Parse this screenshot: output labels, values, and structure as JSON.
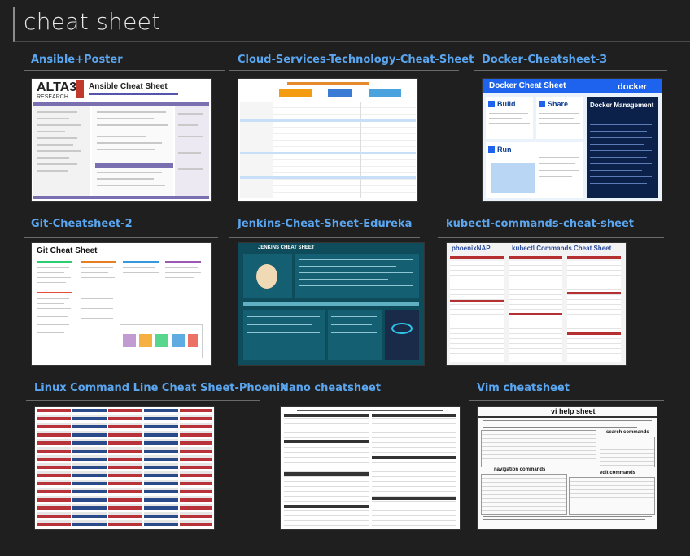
{
  "header": {
    "title": "cheat sheet"
  },
  "cards": [
    {
      "label": "Ansible+Poster",
      "thumb_title": "Ansible Cheat Sheet",
      "thumb_logo": "ALTA3",
      "thumb_logo_sub": "RESEARCH"
    },
    {
      "label": "Cloud-Services-Technology-Cheat-Sheet"
    },
    {
      "label": "Docker-Cheatsheet-3",
      "thumb_title": "Docker Cheat Sheet",
      "thumb_brand": "docker",
      "sections": [
        "Build",
        "Share",
        "Run",
        "Docker Management"
      ]
    },
    {
      "label": "Git-Cheatsheet-2",
      "thumb_title": "Git Cheat Sheet"
    },
    {
      "label": "Jenkins-Cheat-Sheet-Edureka",
      "thumb_title": "JENKINS CHEAT SHEET"
    },
    {
      "label": "kubectl-commands-cheat-sheet",
      "thumb_brand": "phoenixNAP",
      "thumb_title": "kubectl Commands Cheat Sheet"
    },
    {
      "label": "Linux Command Line Cheat Sheet-Phoenix"
    },
    {
      "label": "Nano cheatsheet"
    },
    {
      "label": "Vim cheatsheet",
      "thumb_title": "vi help sheet",
      "sections": [
        "search commands",
        "navigation commands",
        "edit commands"
      ]
    }
  ]
}
